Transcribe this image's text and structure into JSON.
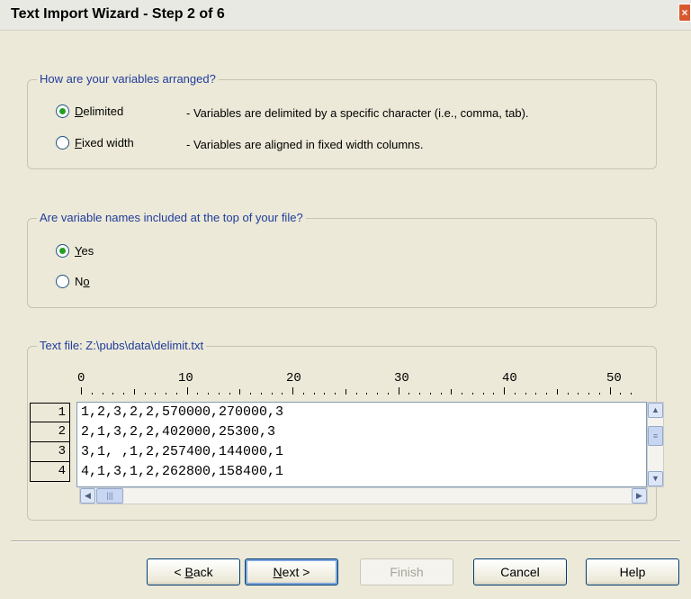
{
  "window": {
    "title": "Text Import Wizard - Step 2 of 6",
    "close_glyph": "×"
  },
  "arrangement": {
    "legend": "How are your variables arranged?",
    "options": [
      {
        "mnemonic": "D",
        "rest": "elimited",
        "description": "- Variables are delimited by a specific character (i.e., comma, tab).",
        "selected": true
      },
      {
        "mnemonic": "F",
        "rest": "ixed width",
        "description": "- Variables are aligned in fixed width columns.",
        "selected": false
      }
    ]
  },
  "names": {
    "legend": "Are variable names included at the top of your file?",
    "options": [
      {
        "before": "",
        "mnemonic": "Y",
        "after": "es",
        "selected": true
      },
      {
        "before": "N",
        "mnemonic": "o",
        "after": "",
        "selected": false
      }
    ]
  },
  "preview": {
    "legend": "Text file: Z:\\pubs\\data\\delimit.txt",
    "ruler_labels": [
      "0",
      "10",
      "20",
      "30",
      "40",
      "50"
    ],
    "row_numbers": [
      "1",
      "2",
      "3",
      "4"
    ],
    "lines": [
      "1,2,3,2,2,570000,270000,3",
      "2,1,3,2,2,402000,25300,3",
      "3,1, ,1,2,257400,144000,1",
      "4,1,3,1,2,262800,158400,1"
    ]
  },
  "scroll_glyphs": {
    "up": "▲",
    "down": "▼",
    "left": "◀",
    "right": "▶",
    "grip": "|||",
    "vgrip": "≡"
  },
  "buttons": {
    "back": {
      "arrow": "< ",
      "mnemonic": "B",
      "rest": "ack"
    },
    "next": {
      "mnemonic": "N",
      "rest": "ext",
      "arrow": " >"
    },
    "finish": "Finish",
    "cancel": "Cancel",
    "help": "Help"
  },
  "colors": {
    "legend_text": "#1f3c9c",
    "radio_dot": "#21a121",
    "dialog_bg": "#ece9d8"
  }
}
